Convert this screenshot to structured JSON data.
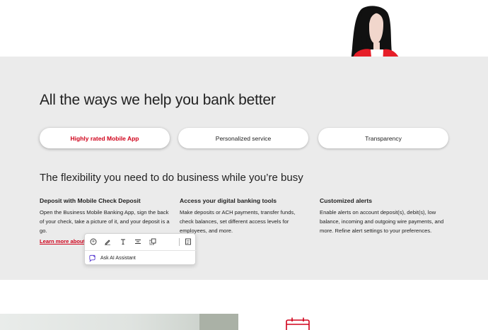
{
  "hero": {
    "title": "All the ways we help you bank better"
  },
  "tabs": [
    {
      "label": "Highly rated Mobile App",
      "active": true
    },
    {
      "label": "Personalized service",
      "active": false
    },
    {
      "label": "Transparency",
      "active": false
    }
  ],
  "subhead": "The flexibility you need to do business while you’re busy",
  "features": [
    {
      "title": "Deposit with Mobile Check Deposit",
      "body": "Open the Business Mobile Banking App, sign the back of your check, take a picture of it, and your deposit is a go.",
      "link": "Learn more about"
    },
    {
      "title": "Access your digital banking tools",
      "body": "Make deposits or ACH payments, transfer funds, check balances, set different access levels for employees, and more."
    },
    {
      "title": "Customized alerts",
      "body": "Enable alerts on account deposit(s), debit(s), low balance, incoming and outgoing wire payments, and more. Refine alert settings to your preferences."
    }
  ],
  "toolbar": {
    "ai_label": "Ask AI Assistant",
    "icons": [
      "comment-icon",
      "highlight-pen-icon",
      "text-icon",
      "align-icon",
      "copy-icon",
      "note-icon"
    ]
  },
  "colors": {
    "brand_red": "#d0021b",
    "band_gray": "#ebebeb"
  }
}
